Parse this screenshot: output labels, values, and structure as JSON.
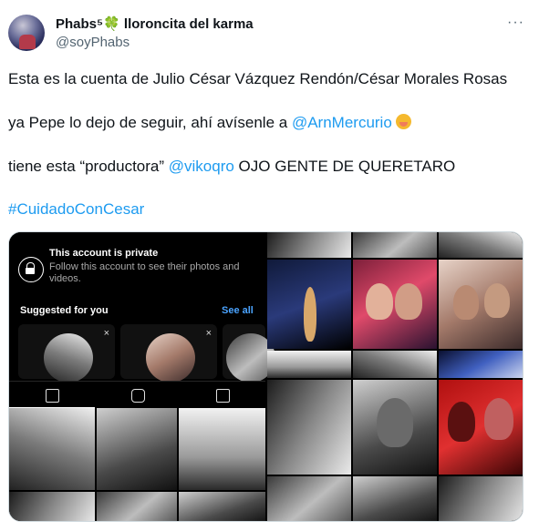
{
  "tweet": {
    "display_name": "Phabs⁵",
    "clover": "🍀",
    "display_name_rest": " lloroncita del karma",
    "handle": "@soyPhabs",
    "more_label": "···",
    "line1": "Esta es la cuenta de Julio César Vázquez Rendón/César Morales Rosas",
    "line2_text": "ya Pepe lo dejo de seguir, ahí avísenle a ",
    "line2_mention": "@ArnMercurio",
    "line3_text": "tiene esta “productora” ",
    "line3_mention": "@vikoqro",
    "line3_rest": " OJO GENTE DE QUERETARO",
    "hashtag": "#CuidadoConCesar",
    "emoji_name": "face-with-hand-over-mouth"
  },
  "instagram": {
    "private_title": "This account is private",
    "private_subtitle": "Follow this account to see their photos and videos.",
    "suggested_label": "Suggested for you",
    "see_all_label": "See all",
    "close_symbol": "×",
    "tab_icons": [
      "grid-icon",
      "reels-icon",
      "tagged-icon"
    ]
  },
  "colors": {
    "link": "#1d9bf0",
    "secondary_text": "#536471",
    "ig_link": "#4aa3ff"
  }
}
